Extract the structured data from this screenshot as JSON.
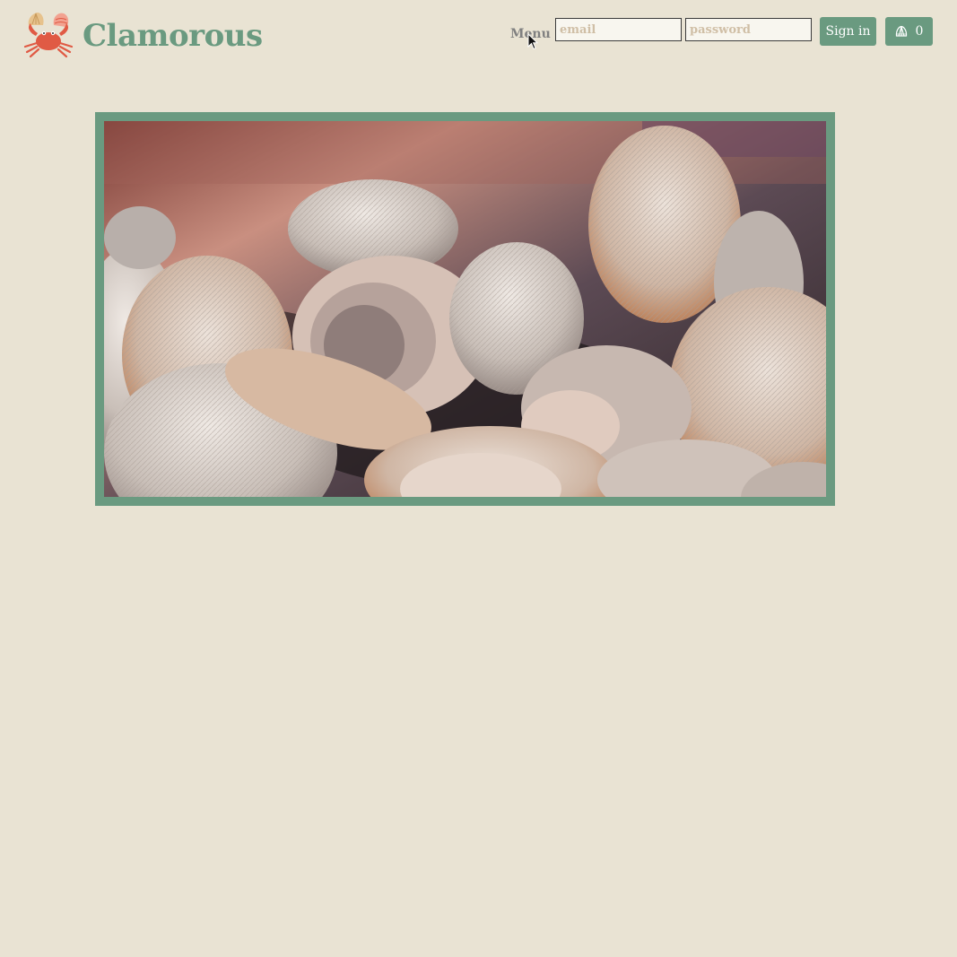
{
  "brand": {
    "name": "Clamorous",
    "logo_icon": "crab-icon"
  },
  "nav": {
    "menu_label": "Menu"
  },
  "login": {
    "email_placeholder": "email",
    "password_placeholder": "password",
    "signin_label": "Sign in"
  },
  "cart": {
    "icon": "shell-icon",
    "count": "0"
  },
  "hero": {
    "subject": "clams-photo"
  },
  "colors": {
    "background": "#e9e3d3",
    "accent": "#6a9a80",
    "logo_red": "#e05a44",
    "menu_text": "#808080"
  }
}
